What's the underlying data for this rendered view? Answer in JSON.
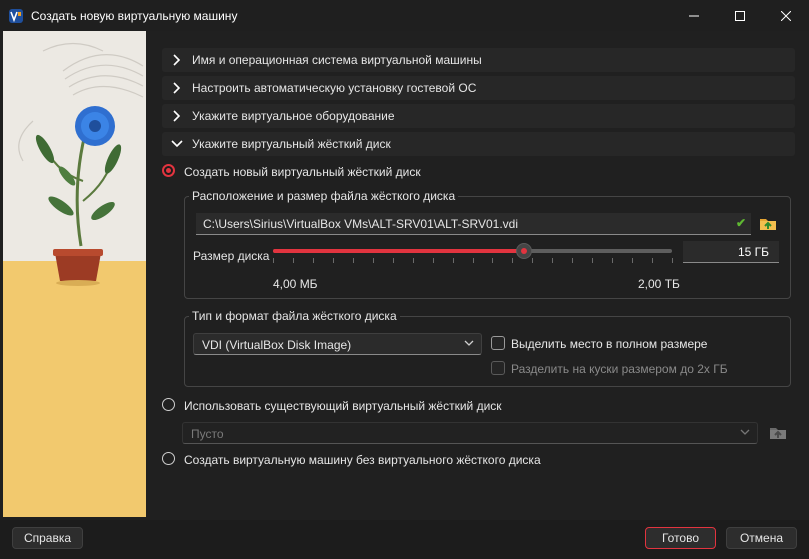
{
  "window": {
    "title": "Создать новую виртуальную машину",
    "accent": "#e2343f"
  },
  "sections": [
    {
      "label": "Имя и операционная система виртуальной машины",
      "expanded": false,
      "icon": "chevron-right-icon"
    },
    {
      "label": "Настроить автоматическую установку гостевой ОС",
      "expanded": false,
      "icon": "chevron-right-icon"
    },
    {
      "label": "Укажите виртуальное оборудование",
      "expanded": false,
      "icon": "chevron-right-icon"
    },
    {
      "label": "Укажите виртуальный жёсткий диск",
      "expanded": true,
      "icon": "chevron-down-icon"
    }
  ],
  "disk": {
    "create_new_label": "Создать новый виртуальный жёсткий диск",
    "location_group_label": "Расположение и размер файла жёсткого диска",
    "path_value": "C:\\Users\\Sirius\\VirtualBox VMs\\ALT-SRV01\\ALT-SRV01.vdi",
    "size_label": "Размер диска",
    "size_value": "15 ГБ",
    "slider_fraction": 0.63,
    "min_label": "4,00 МБ",
    "max_label": "2,00 ТБ",
    "type_group_label": "Тип и формат файла жёсткого диска",
    "format_value": "VDI (VirtualBox Disk Image)",
    "preallocate_label": "Выделить место в полном размере",
    "split_label": "Разделить на куски размером до 2х ГБ",
    "use_existing_label": "Использовать существующий виртуальный жёсткий диск",
    "existing_value": "Пусто",
    "no_disk_label": "Создать виртуальную машину без виртуального жёсткого диска"
  },
  "footer": {
    "help": "Справка",
    "finish": "Готово",
    "cancel": "Отмена"
  }
}
